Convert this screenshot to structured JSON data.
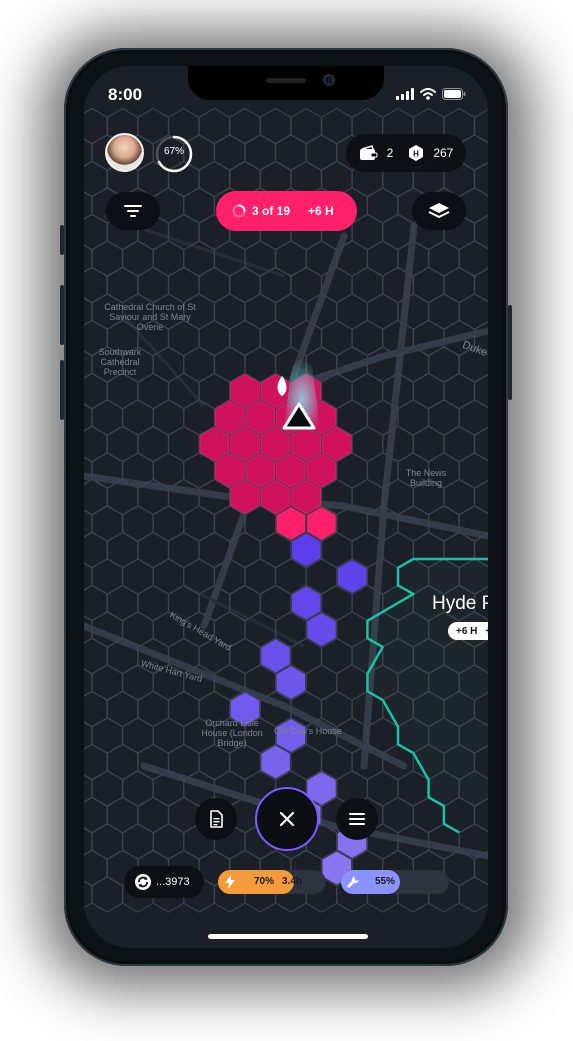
{
  "status_bar": {
    "time": "8:00"
  },
  "header": {
    "level_progress_label": "67%",
    "level_progress": 0.67,
    "resource_a_count": "2",
    "resource_b_count": "267"
  },
  "hunt": {
    "progress_label": "3 of 19",
    "hours_label": "+6 H"
  },
  "map": {
    "labels": {
      "cathedral": "Cathedral Church of St Saviour and St Mary Overie",
      "southwark": "Southwark Cathedral Precinct",
      "duke": "Duke",
      "news_building": "The News Building",
      "kings_head": "King's Head Yard",
      "white_hart": "White Hart Yard",
      "orchard": "Orchard Lisle House (London Bridge)",
      "old_guys": "Old Guy's House"
    },
    "zone": {
      "title": "Hyde P",
      "badge_hours": "+6 H",
      "badge_extra": "+"
    },
    "colors": {
      "trail": "#7b6cf0",
      "captured": "#d0125a",
      "zone_border": "#19c2a7"
    }
  },
  "bottom": {
    "token_label": "...3973",
    "energy": {
      "percent_label": "70%",
      "time_label": "3.4h",
      "level": 0.7,
      "color": "#f49b3c"
    },
    "durability": {
      "percent_label": "55%",
      "level": 0.55,
      "color": "#8a93ff"
    }
  }
}
